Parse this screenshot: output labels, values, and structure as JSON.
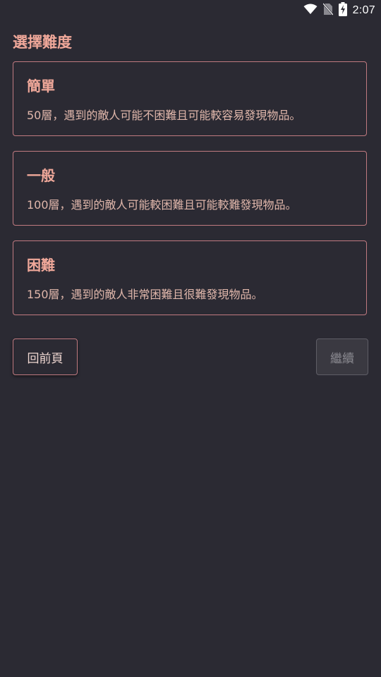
{
  "status_bar": {
    "time": "2:07",
    "icons": [
      "wifi-icon",
      "no-sim-icon",
      "battery-charging-icon"
    ]
  },
  "page": {
    "title": "選擇難度"
  },
  "difficulties": [
    {
      "title": "簡單",
      "description": "50層，遇到的敵人可能不困難且可能較容易發現物品。"
    },
    {
      "title": "一般",
      "description": "100層，遇到的敵人可能較困難且可能較難發現物品。"
    },
    {
      "title": "困難",
      "description": "150層，遇到的敵人非常困難且很難發現物品。"
    }
  ],
  "buttons": {
    "back_label": "回前頁",
    "continue_label": "繼續"
  },
  "colors": {
    "background": "#2b2a33",
    "accent": "#f0a89a",
    "border": "#c07a80"
  }
}
